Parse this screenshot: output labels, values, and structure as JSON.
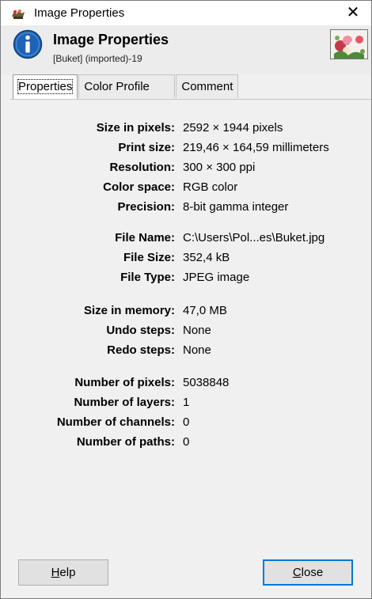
{
  "window": {
    "title": "Image Properties",
    "close_glyph": "✕"
  },
  "header": {
    "title": "Image Properties",
    "subtitle": "[Buket] (imported)-19",
    "icon": "info-icon"
  },
  "tabs": [
    {
      "label": "Properties",
      "active": true
    },
    {
      "label": "Color Profile",
      "active": false
    },
    {
      "label": "Comment",
      "active": false
    }
  ],
  "properties": {
    "size_in_pixels": {
      "label": "Size in pixels:",
      "value": "2592 × 1944 pixels"
    },
    "print_size": {
      "label": "Print size:",
      "value": "219,46 × 164,59 millimeters"
    },
    "resolution": {
      "label": "Resolution:",
      "value": "300 × 300 ppi"
    },
    "color_space": {
      "label": "Color space:",
      "value": "RGB color"
    },
    "precision": {
      "label": "Precision:",
      "value": "8-bit gamma integer"
    },
    "file_name": {
      "label": "File Name:",
      "value": "C:\\Users\\Pol...es\\Buket.jpg"
    },
    "file_size": {
      "label": "File Size:",
      "value": "352,4 kB"
    },
    "file_type": {
      "label": "File Type:",
      "value": "JPEG image"
    },
    "size_in_memory": {
      "label": "Size in memory:",
      "value": "47,0 MB"
    },
    "undo_steps": {
      "label": "Undo steps:",
      "value": "None"
    },
    "redo_steps": {
      "label": "Redo steps:",
      "value": "None"
    },
    "num_pixels": {
      "label": "Number of pixels:",
      "value": "5038848"
    },
    "num_layers": {
      "label": "Number of layers:",
      "value": "1"
    },
    "num_channels": {
      "label": "Number of channels:",
      "value": "0"
    },
    "num_paths": {
      "label": "Number of paths:",
      "value": "0"
    }
  },
  "buttons": {
    "help_mnemonic": "H",
    "help_rest": "elp",
    "close_mnemonic": "C",
    "close_rest": "lose"
  },
  "colors": {
    "accent": "#0078d7",
    "info_icon": "#1e63b5"
  }
}
